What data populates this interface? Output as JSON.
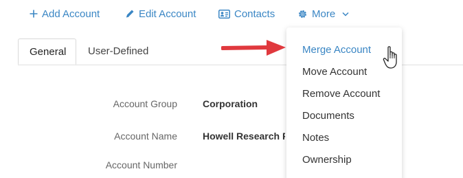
{
  "toolbar": {
    "add_label": "Add Account",
    "edit_label": "Edit Account",
    "contacts_label": "Contacts",
    "more_label": "More"
  },
  "tabs": [
    {
      "label": "General",
      "active": true
    },
    {
      "label": "User-Defined",
      "active": false
    }
  ],
  "form": {
    "fields": [
      {
        "label": "Account Group",
        "value": "Corporation"
      },
      {
        "label": "Account Name",
        "value": "Howell Research F"
      },
      {
        "label": "Account Number",
        "value": ""
      }
    ]
  },
  "more_menu": {
    "items": [
      {
        "label": "Merge Account",
        "highlighted": true
      },
      {
        "label": "Move Account"
      },
      {
        "label": "Remove Account"
      },
      {
        "label": "Documents"
      },
      {
        "label": "Notes"
      },
      {
        "label": "Ownership"
      }
    ]
  },
  "colors": {
    "accent": "#3a86c4",
    "arrow": "#e0393e"
  },
  "icons": {
    "add": "plus-icon",
    "edit": "pencil-icon",
    "contacts": "contact-card-icon",
    "more": "gear-icon",
    "more_caret": "chevron-down-icon"
  }
}
